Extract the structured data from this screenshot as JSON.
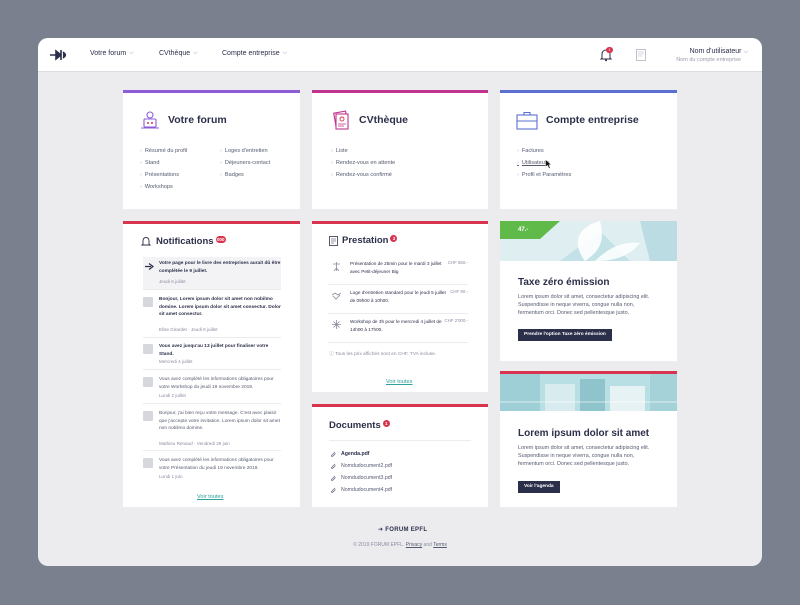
{
  "topbar": {
    "nav": [
      {
        "label": "Votre forum"
      },
      {
        "label": "CVthèque"
      },
      {
        "label": "Compte entreprise"
      }
    ],
    "notification_count": "1",
    "user_name": "Nom d'utilisateur",
    "company_name": "Nom du compte entreprise"
  },
  "cards": {
    "forum": {
      "title": "Votre forum",
      "links_left": [
        "Résumé du profil",
        "Stand",
        "Présentations",
        "Workshops"
      ],
      "links_right": [
        "Loges d'entretien",
        "Déjeuners-contact",
        "Badges"
      ]
    },
    "cvtheque": {
      "title": "CVthèque",
      "links": [
        "Liste",
        "Rendez-vous en attente",
        "Rendez-vous confirmé"
      ]
    },
    "compte": {
      "title": "Compte entreprise",
      "links": [
        "Factures",
        "Utilisateurs",
        "Profil et Paramètres"
      ]
    }
  },
  "notifications": {
    "title": "Notifications",
    "badge": "000",
    "items": [
      {
        "text": "Votre page pour le livre des entreprises aurait dû être complétée le 9 juillet.",
        "meta": "Jeudi 6 juillet",
        "bold": true
      },
      {
        "text": "Bonjour, Lorem ipsum dolor sit amet non nobilmo domine. Lorem ipsum dolor sit amet consectur. Dolor sit amet consectur.",
        "meta": "Elise Girardet · Jeudi 6 juillet",
        "bold": true
      },
      {
        "text": "Vous avez jusqu'au 13 juillet pour finaliser votre Stand.",
        "meta": "Mercredi 4 juillet",
        "bold": true
      },
      {
        "text": "Vous avez complété les informations obligatoires pour votre Workshop du jeudi 19 novembre 2019.",
        "meta": "Lundi 2 juillet",
        "bold": false
      },
      {
        "text": "Bonjour, j'ai bien reçu votre message. C'est avec plaisir que j'accepte votre invitation. Lorem ipsum dolor sit amet non nobilmo domine.",
        "meta": "Mathieu Renaud · Vendredi 29 juin",
        "bold": false
      },
      {
        "text": "Vous avez complété les informations obligatoires pour votre Présentation du jeudi 19 novembre 2019.",
        "meta": "Lundi 1 juin",
        "bold": false
      }
    ],
    "see_all": "Voir toutes"
  },
  "prestation": {
    "title": "Prestation",
    "badge": "3",
    "items": [
      {
        "text": "Présentation de 25min pour le mardi 3 juillet avec Petit-déjeuner Big",
        "price": "CHF 550.-"
      },
      {
        "text": "Loge d'entretien standard pour le jeudi 5 juillet de 09h00 à 10h00.",
        "price": "CHF 90.-"
      },
      {
        "text": "Workshop de 3h pour le mercredi 4 juillet de 14h00 à 17h00.",
        "price": "CHF 2'000.-"
      }
    ],
    "note": "Tous les prix affichés sont en CHF, TVA incluse.",
    "see_all": "Voir toutes"
  },
  "documents": {
    "title": "Documents",
    "badge": "1",
    "items": [
      {
        "name": "Agenda.pdf",
        "bold": true
      },
      {
        "name": "Nomdudocument2.pdf",
        "bold": false
      },
      {
        "name": "Nomdudocument3.pdf",
        "bold": false
      },
      {
        "name": "Nomdudocument4.pdf",
        "bold": false
      }
    ]
  },
  "promo_taxe": {
    "tag": "47.-",
    "title": "Taxe zéro émission",
    "text": "Lorem ipsum dolor sit amet, consectetur adipiscing elit. Suspendisse in neque viverra, congue nulla non, fermentum orci. Donec sed pellentesque justo.",
    "button": "Prendre l'option Taxe zéro émission"
  },
  "promo_agenda": {
    "title": "Lorem ipsum dolor sit amet",
    "text": "Lorem ipsum dolor sit amet, consectetur adipiscing elit. Suspendisse in neque viverra, congue nulla non, fermentum orci. Donec sed pellentesque justo.",
    "button": "Voir l'agenda"
  },
  "footer": {
    "logo": "FORUM EPFL",
    "copyright": "© 2019 FORUM EPFL.",
    "privacy": "Privacy",
    "and": "and",
    "terms": "Terms"
  },
  "colors": {
    "forum_accent": "#8d5cd6",
    "cvtheque_accent": "#c2338f",
    "compte_accent": "#5b6fd1",
    "notif_accent": "#d8334f",
    "dark_button": "#2c2f4a",
    "link_teal": "#2aa19a"
  }
}
